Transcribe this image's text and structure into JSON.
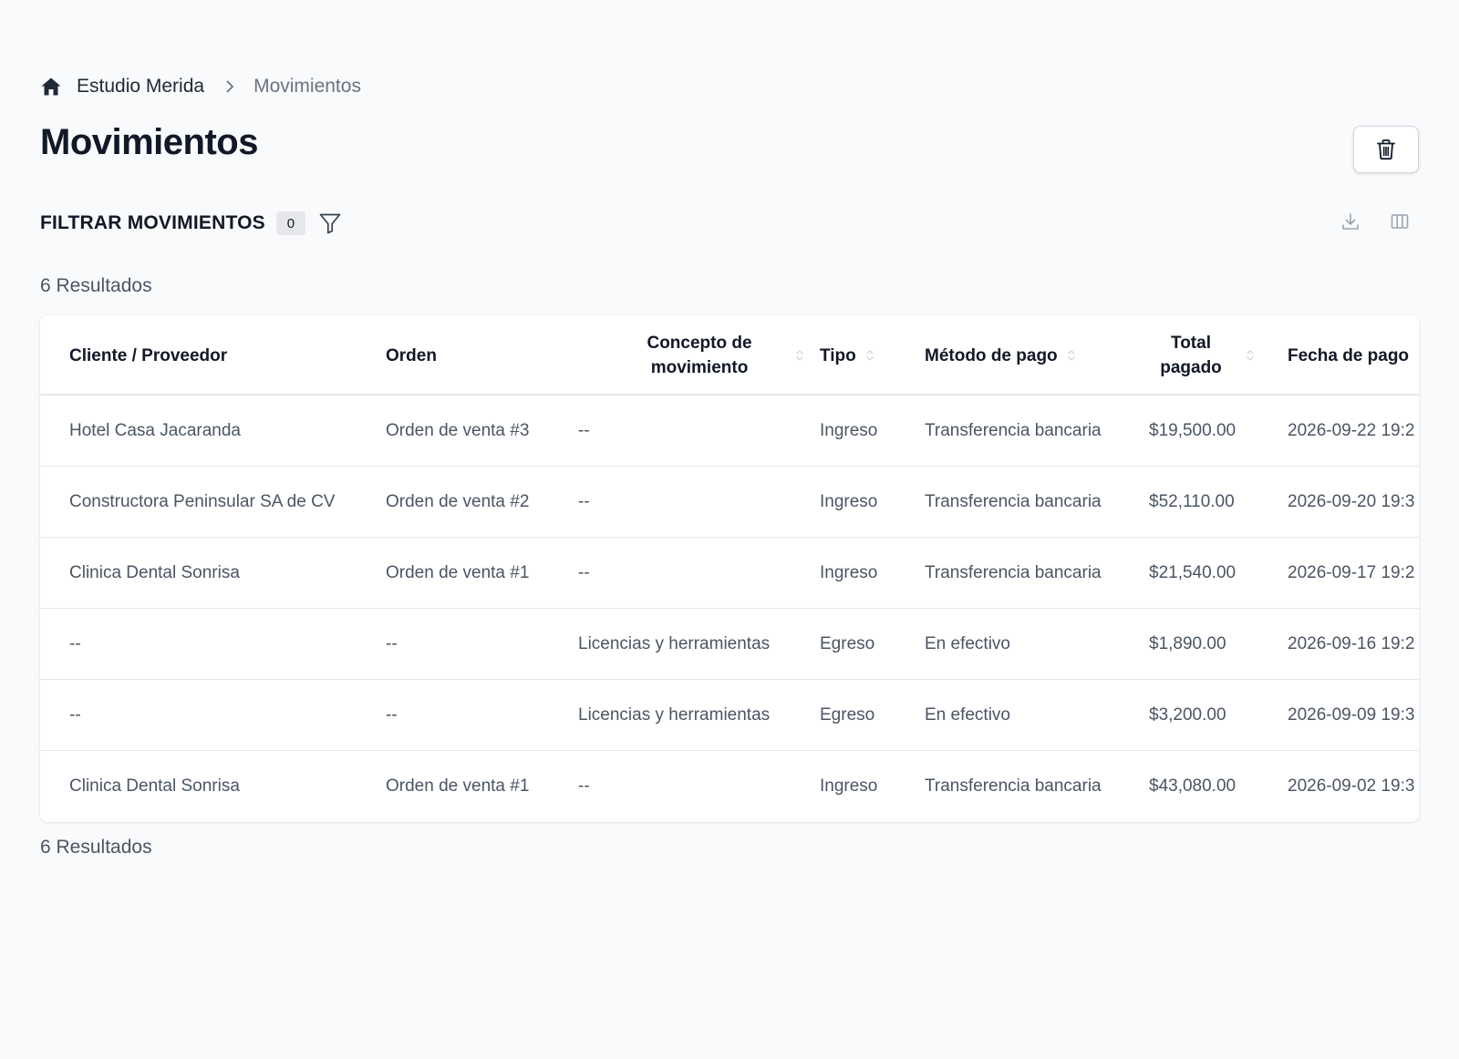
{
  "breadcrumb": {
    "root": "Estudio Merida",
    "current": "Movimientos"
  },
  "page": {
    "title": "Movimientos"
  },
  "filter": {
    "title": "FILTRAR MOVIMIENTOS",
    "count": "0"
  },
  "results": {
    "label": "6 Resultados"
  },
  "table": {
    "headers": {
      "cliente": "Cliente / Proveedor",
      "orden": "Orden",
      "concepto_line1": "Concepto de",
      "concepto_line2": "movimiento",
      "tipo": "Tipo",
      "metodo": "Método de pago",
      "total_line1": "Total",
      "total_line2": "pagado",
      "fecha": "Fecha de pago"
    },
    "rows": [
      {
        "cliente": "Hotel Casa Jacaranda",
        "orden": "Orden de venta #3",
        "concepto": "--",
        "tipo": "Ingreso",
        "metodo": "Transferencia bancaria",
        "total": "$19,500.00",
        "fecha": "2026-09-22 19:2"
      },
      {
        "cliente": "Constructora Peninsular SA de CV",
        "orden": "Orden de venta #2",
        "concepto": "--",
        "tipo": "Ingreso",
        "metodo": "Transferencia bancaria",
        "total": "$52,110.00",
        "fecha": "2026-09-20 19:3"
      },
      {
        "cliente": "Clinica Dental Sonrisa",
        "orden": "Orden de venta #1",
        "concepto": "--",
        "tipo": "Ingreso",
        "metodo": "Transferencia bancaria",
        "total": "$21,540.00",
        "fecha": "2026-09-17 19:2"
      },
      {
        "cliente": "--",
        "orden": "--",
        "concepto": "Licencias y herramientas",
        "tipo": "Egreso",
        "metodo": "En efectivo",
        "total": "$1,890.00",
        "fecha": "2026-09-16 19:2"
      },
      {
        "cliente": "--",
        "orden": "--",
        "concepto": "Licencias y herramientas",
        "tipo": "Egreso",
        "metodo": "En efectivo",
        "total": "$3,200.00",
        "fecha": "2026-09-09 19:3"
      },
      {
        "cliente": "Clinica Dental Sonrisa",
        "orden": "Orden de venta #1",
        "concepto": "--",
        "tipo": "Ingreso",
        "metodo": "Transferencia bancaria",
        "total": "$43,080.00",
        "fecha": "2026-09-02 19:3"
      }
    ]
  },
  "icons": {
    "home": "home-icon",
    "chevron": "chevron-right-icon",
    "trash": "trash-icon",
    "filter": "filter-icon",
    "download": "download-icon",
    "columns": "columns-icon",
    "sort": "sort-icon"
  },
  "colors": {
    "background": "#f9fafb",
    "card": "#ffffff",
    "text_primary": "#111827",
    "text_secondary": "#4b5563",
    "border": "#e5e7eb"
  }
}
